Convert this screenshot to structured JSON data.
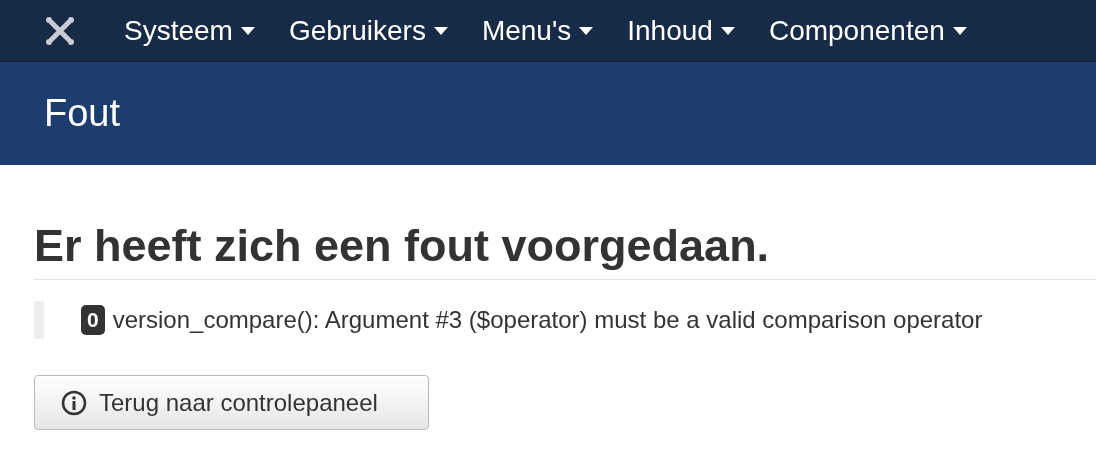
{
  "navbar": {
    "menus": [
      {
        "label": "Systeem"
      },
      {
        "label": "Gebruikers"
      },
      {
        "label": "Menu's"
      },
      {
        "label": "Inhoud"
      },
      {
        "label": "Componenten"
      }
    ]
  },
  "header": {
    "title": "Fout"
  },
  "content": {
    "heading": "Er heeft zich een fout voorgedaan.",
    "error": {
      "code": "0",
      "message": "version_compare(): Argument #3 ($operator) must be a valid comparison operator"
    },
    "back_button": "Terug naar controlepaneel"
  }
}
